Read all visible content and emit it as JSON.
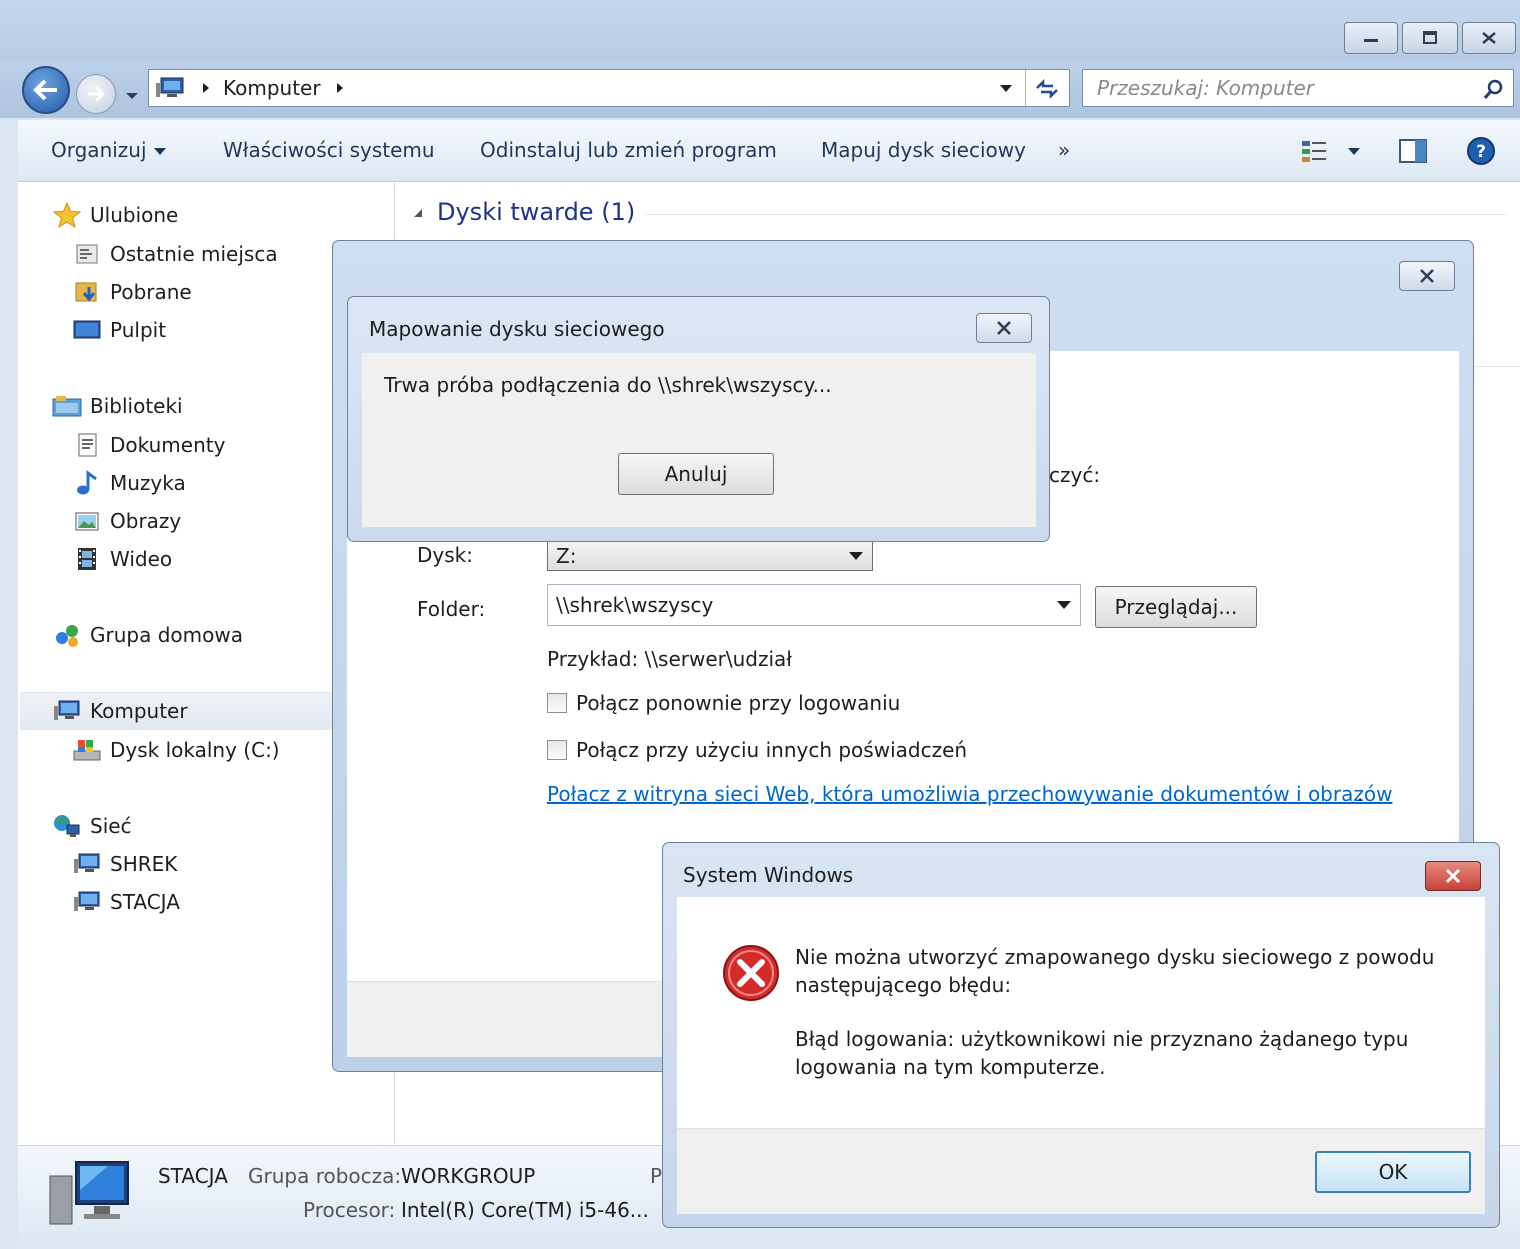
{
  "explorer": {
    "address": {
      "crumb": "Komputer"
    },
    "search": {
      "placeholder": "Przeszukaj: Komputer"
    },
    "toolbar": {
      "organize": "Organizuj",
      "system_properties": "Właściwości systemu",
      "uninstall": "Odinstaluj lub zmień program",
      "map_drive": "Mapuj dysk sieciowy",
      "more": "»"
    },
    "nav": {
      "favorites": "Ulubione",
      "recent": "Ostatnie miejsca",
      "downloads": "Pobrane",
      "desktop": "Pulpit",
      "libraries": "Biblioteki",
      "documents": "Dokumenty",
      "music": "Muzyka",
      "pictures": "Obrazy",
      "video": "Wideo",
      "homegroup": "Grupa domowa",
      "computer": "Komputer",
      "local_disk": "Dysk lokalny (C:)",
      "network": "Sieć",
      "shrek": "SHREK",
      "stacja": "STACJA"
    },
    "content": {
      "group_header": "Dyski twarde (1)"
    },
    "details": {
      "name": "STACJA",
      "workgroup_label": "Grupa robocza:",
      "workgroup_value": "WORKGROUP",
      "processor_label": "Procesor:",
      "processor_value": "Intel(R) Core(TM) i5-46...",
      "cut_letter": "P"
    }
  },
  "wizard": {
    "partial_text": "czyć:",
    "drive_label": "Dysk:",
    "drive_value": "Z:",
    "folder_label": "Folder:",
    "folder_value": "\\\\shrek\\wszyscy",
    "browse": "Przeglądaj...",
    "example": "Przykład: \\\\serwer\\udział",
    "reconnect": "Połącz ponownie przy logowaniu",
    "other_credentials": "Połącz przy użyciu innych poświadczeń",
    "web_link": "Połacz z witryna sieci Web, która umożliwia przechowywanie dokumentów i obrazów",
    "link_period": "."
  },
  "connecting": {
    "title": "Mapowanie dysku sieciowego",
    "message": "Trwa próba podłączenia do \\\\shrek\\wszyscy...",
    "cancel": "Anuluj"
  },
  "error": {
    "title": "System Windows",
    "line1": "Nie można utworzyć zmapowanego dysku sieciowego z powodu",
    "line2": "następującego błędu:",
    "line3": "Błąd logowania: użytkownikowi nie przyznano żądanego typu",
    "line4": "logowania na tym komputerze.",
    "ok": "OK"
  },
  "colors": {
    "link": "#0066cc",
    "error_red": "#d42a2a",
    "close_red": "#c8413a"
  }
}
